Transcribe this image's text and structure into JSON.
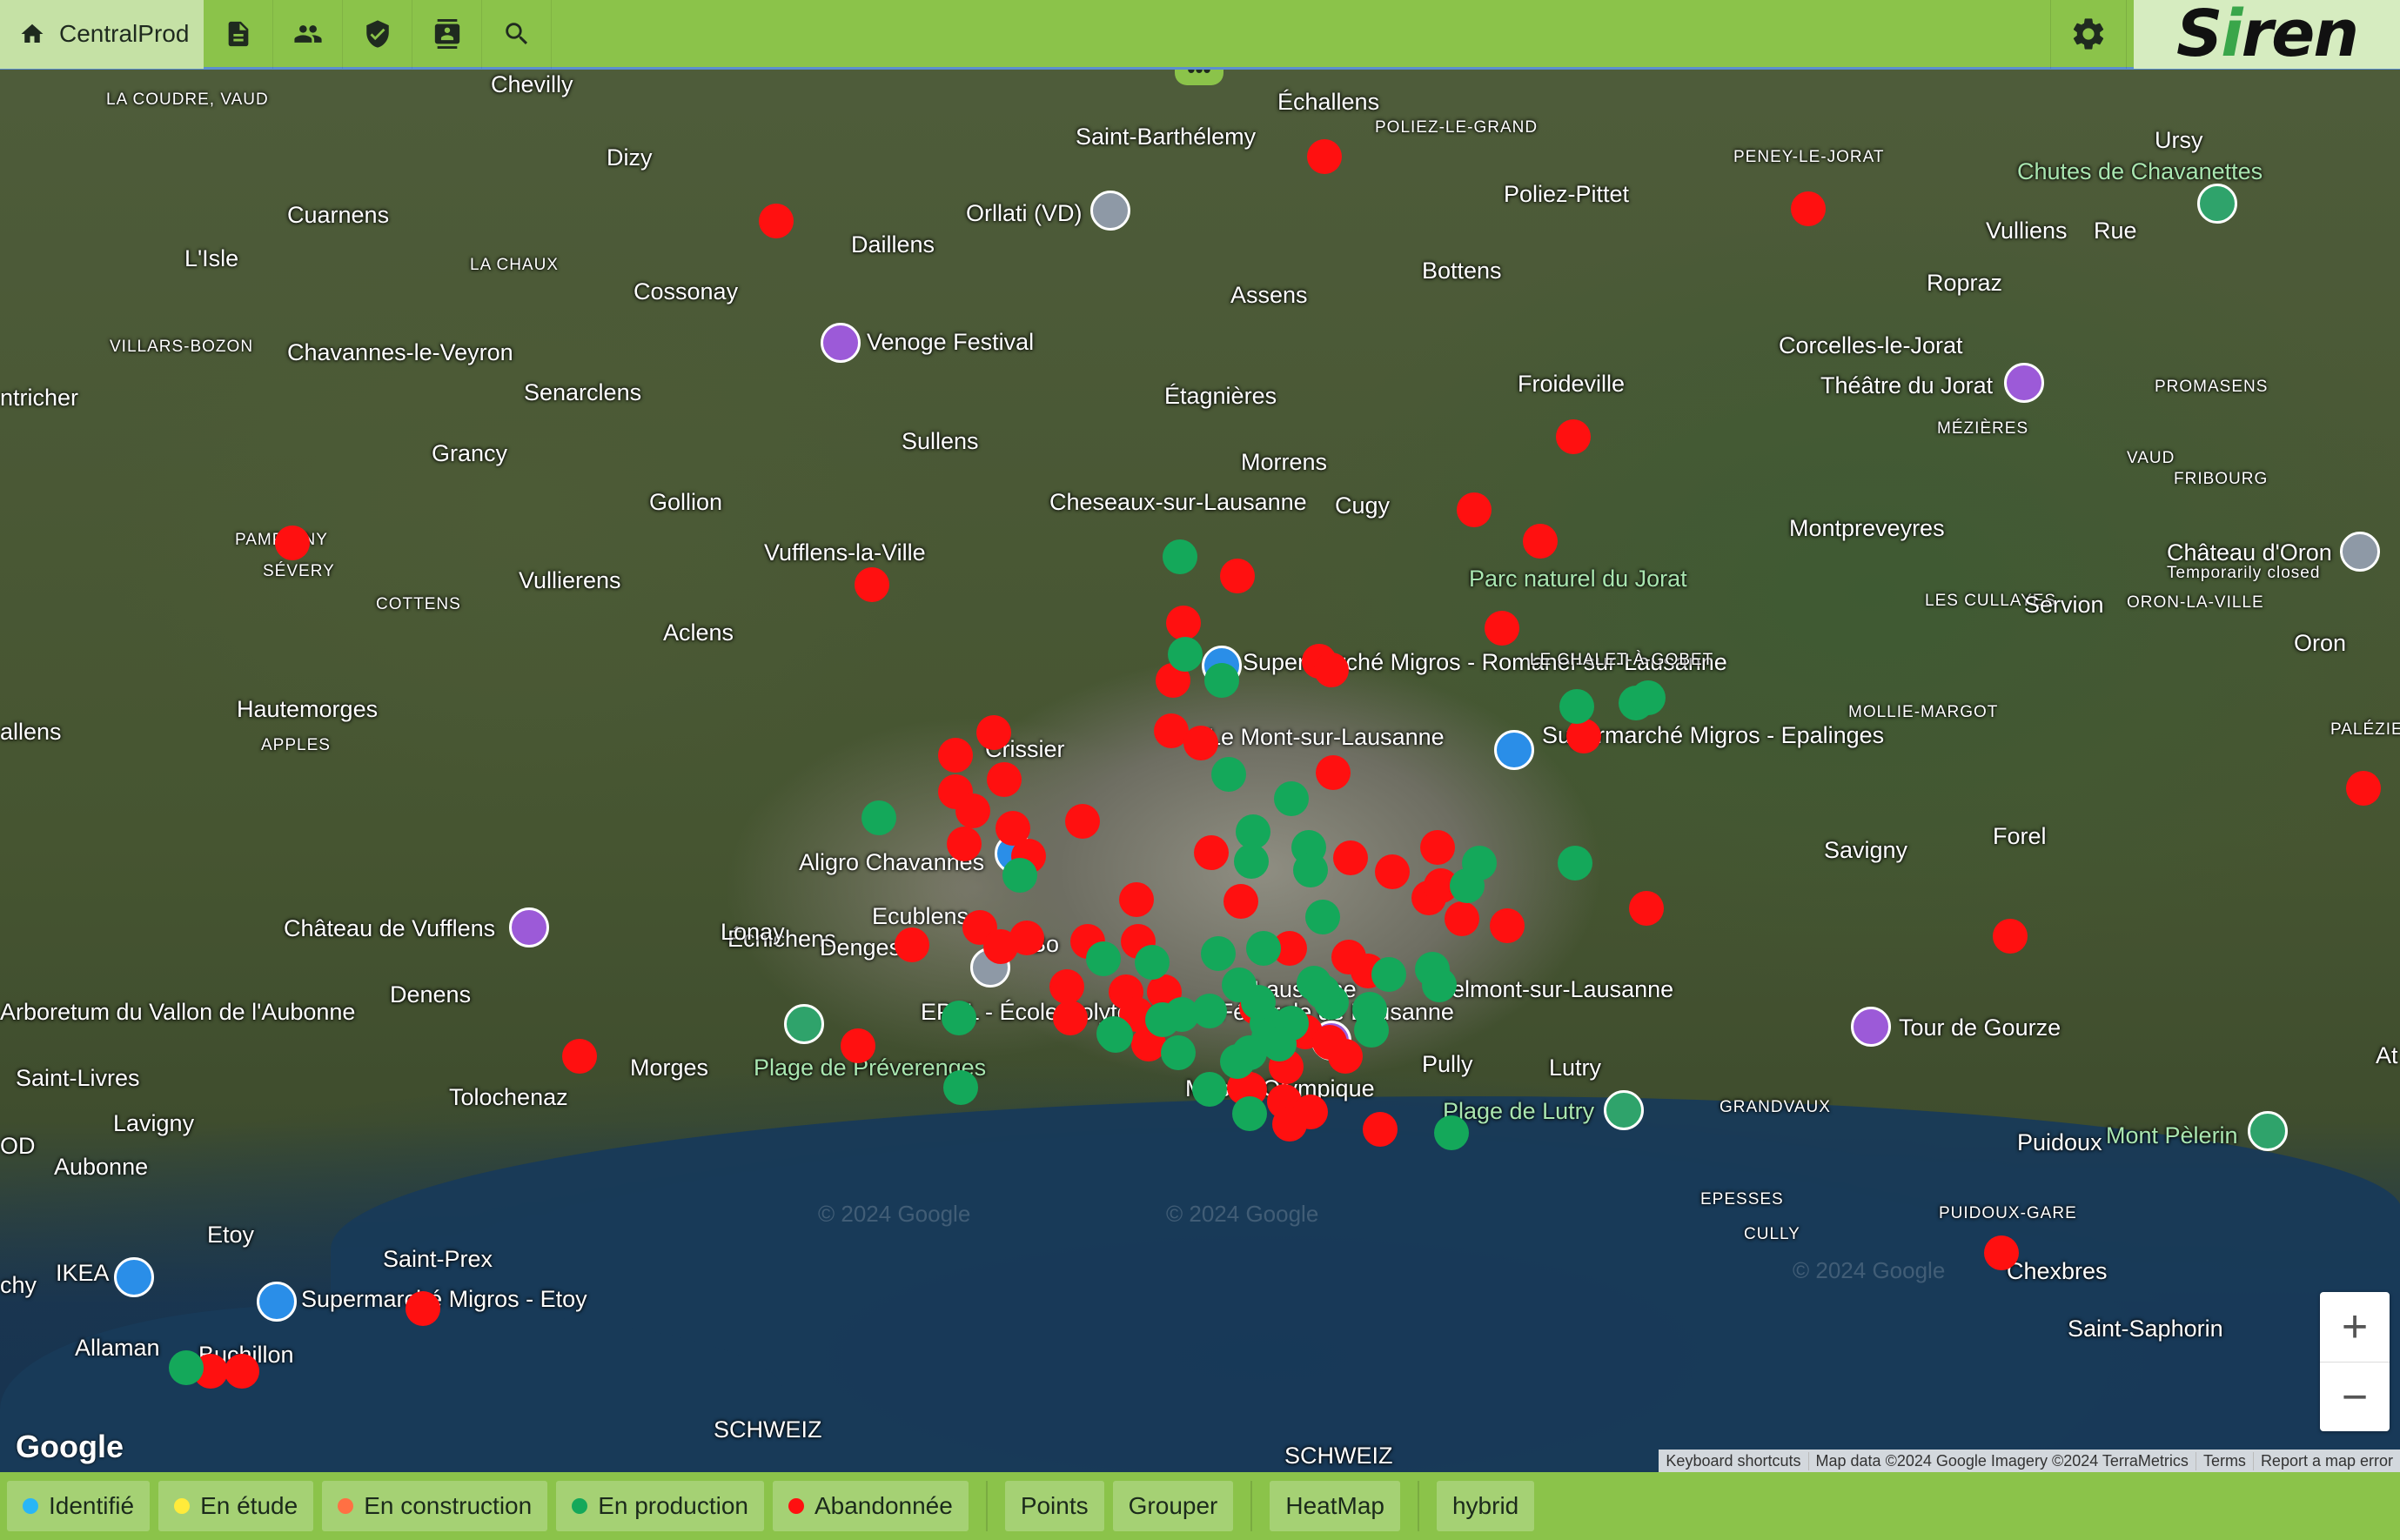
{
  "topbar": {
    "home_label": "CentralProd",
    "icons": [
      "home-icon",
      "document-icon",
      "people-icon",
      "shield-check-icon",
      "contact-card-icon",
      "search-icon",
      "gear-icon"
    ],
    "logo_text_a": "S",
    "logo_text_b": "i",
    "logo_text_c": "ren"
  },
  "map": {
    "places": [
      "Chevilly",
      "Dizy",
      "Saint-Barthélemy",
      "Échallens",
      "POLIEZ-LE-GRAND",
      "PENEY-LE-JORAT",
      "Ursy",
      "LA COUDRE, VAUD",
      "Cuarnens",
      "Orllati (VD)",
      "Poliez-Pittet",
      "Chutes de Chavanettes",
      "L'Isle",
      "LA CHAUX",
      "Daillens",
      "Vulliens",
      "Rue",
      "Cossonay",
      "Assens",
      "Bottens",
      "Ropraz",
      "VILLARS-BOZON",
      "Venoge Festival",
      "Corcelles-le-Jorat",
      "Chavannes-le-Veyron",
      "Froideville",
      "Théâtre du Jorat",
      "ntricher",
      "Senarclens",
      "Étagnières",
      "PROMASENS",
      "MÉZIÈRES",
      "Sullens",
      "Grancy",
      "Morrens",
      "Gollion",
      "Cheseaux-sur-Lausanne",
      "Cugy",
      "Montpreveyres",
      "VAUD",
      "FRIBOURG",
      "PAMPIGNY",
      "Vufflens-la-Ville",
      "Parc naturel du Jorat",
      "Château d'Oron",
      "Temporarily closed",
      "SÉVERY",
      "Vullierens",
      "COTTENS",
      "LES CULLAYES",
      "Servion",
      "ORON-LA-VILLE",
      "Aclens",
      "Supermarché Migros - Romanel-sur-Lausanne",
      "LE CHALET-À-GOBET",
      "Oron",
      "Hautemorges",
      "allens",
      "MOLLIE-MARGOT",
      "APPLES",
      "Le Mont-sur-Lausanne",
      "Supermarché Migros - Epalinges",
      "PALÉZIEUX",
      "Crissier",
      "Savigny",
      "Forel",
      "Aligro Chavannes",
      "Ecublens",
      "Château de Vufflens",
      "Échichens",
      "Lonay",
      "Denges",
      "Bo",
      "Denens",
      "Lausanne",
      "Belmont-sur-Lausanne",
      "Arboretum du Vallon de l'Aubonne",
      "EPFL - École Polytechnique Fédérale de Lausanne",
      "Tour de Gourze",
      "Saint-Livres",
      "Morges",
      "Plage de Préverenges",
      "At",
      "Tolochenaz",
      "Pully",
      "Lutry",
      "Musée Olympique",
      "Plage de Lutry",
      "GRANDVAUX",
      "Lavigny",
      "Mont Pèlerin",
      "Puidoux",
      "OD",
      "Aubonne",
      "EPESSES",
      "PUIDOUX-GARE",
      "CULLY",
      "Etoy",
      "Saint-Prex",
      "chy",
      "IKEA",
      "Supermarché Migros - Etoy",
      "Chexbres",
      "Allaman",
      "Buchillon",
      "Saint-Saphorin",
      "SCHWEIZ",
      "SCHWEIZ"
    ],
    "google_logo": "Google",
    "zoom_in": "+",
    "zoom_out": "−",
    "attribution": {
      "keyboard": "Keyboard shortcuts",
      "data": "Map data ©2024 Google Imagery ©2024 TerraMetrics",
      "terms": "Terms",
      "report": "Report a map error"
    },
    "watermarks": [
      "© 2024 Google",
      "© 2024 Google",
      "© 2024 Google"
    ],
    "menu_dots": "•••"
  },
  "legend": {
    "items": [
      {
        "label": "Identifié",
        "color": "#29b6f6"
      },
      {
        "label": "En étude",
        "color": "#ffeb3b"
      },
      {
        "label": "En construction",
        "color": "#ff7043"
      },
      {
        "label": "En production",
        "color": "#14a85a"
      },
      {
        "label": "Abandonnée",
        "color": "#ff1010"
      }
    ],
    "buttons": {
      "points": "Points",
      "grouper": "Grouper",
      "heatmap": "HeatMap",
      "hybrid": "hybrid"
    }
  }
}
